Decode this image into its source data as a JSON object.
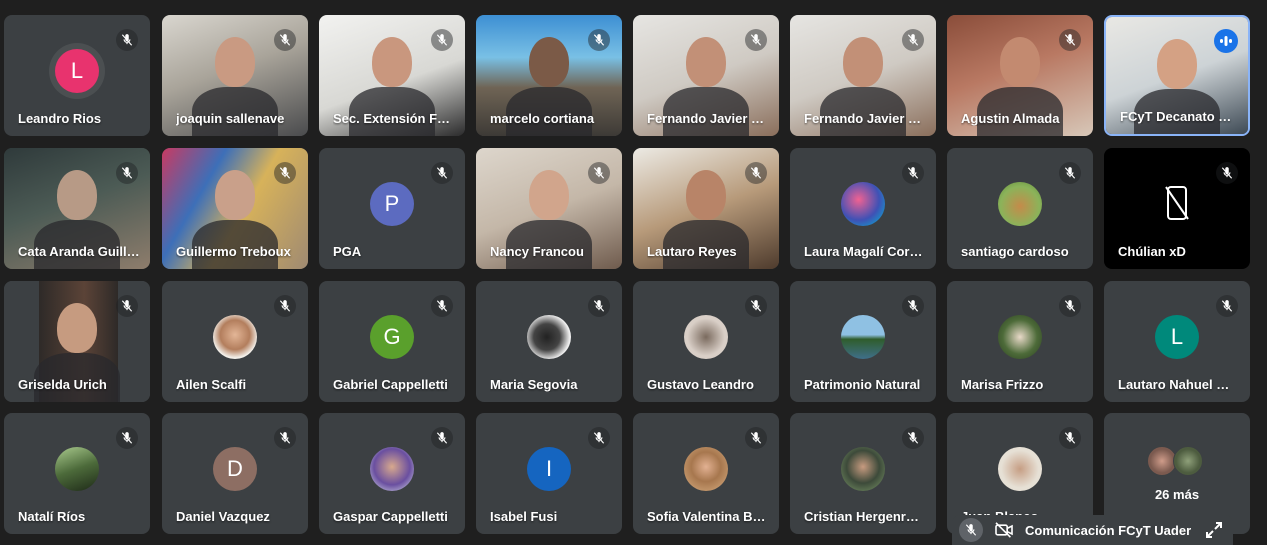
{
  "participants": [
    {
      "name": "Leandro Rios",
      "type": "initial",
      "initial": "L",
      "color": "#e8336e"
    },
    {
      "name": "joaquin sallenave",
      "type": "video",
      "bg": "linear-gradient(160deg,#d9d6cf 0%,#a9a49a 45%,#4a4b4d 100%)",
      "face": "#c99a82"
    },
    {
      "name": "Sec. Extensión FCyT",
      "type": "video",
      "bg": "linear-gradient(160deg,#f2f2f0 0%,#d8d8d4 55%,#2b2b2c 100%)",
      "face": "#c9977e"
    },
    {
      "name": "marcelo cortiana",
      "type": "video",
      "bg": "linear-gradient(180deg,#3d8fd3 0%,#79c0e5 35%,#6f6455 60%,#3d3a36 100%)",
      "face": "#7b5a47"
    },
    {
      "name": "Fernando Javier Rodriguez",
      "type": "video",
      "bg": "linear-gradient(160deg,#e6e5e2 0%,#cfcac3 50%,#8a6e5b 100%)",
      "face": "#c29077"
    },
    {
      "name": "Fernando Javier Rodriguez",
      "type": "video",
      "bg": "linear-gradient(160deg,#e6e5e2 0%,#cfcac3 50%,#8a6e5b 100%)",
      "face": "#c29077"
    },
    {
      "name": "Agustin Almada",
      "type": "video",
      "bg": "linear-gradient(160deg,#8a4d3a 0%,#b97963 45%,#d7c7b8 100%)",
      "face": "#c38a70"
    },
    {
      "name": "FCyT Decanato FCyT",
      "type": "video",
      "active": true,
      "bg": "linear-gradient(160deg,#e9e8e4 0%,#cdd3d6 50%,#3e4a55 100%)",
      "face": "#d4a184"
    },
    {
      "name": "Cata Aranda Guillermo",
      "type": "video",
      "bg": "linear-gradient(160deg,#2f3a3b 0%,#4c5b55 45%,#8e7d6c 100%)",
      "face": "#b79a86"
    },
    {
      "name": "Guillermo Treboux",
      "type": "video",
      "bg": "linear-gradient(120deg,#c83a62 0%,#3d6fb8 30%,#d7b25a 55%,#9f8a72 100%)",
      "face": "#c9a08a"
    },
    {
      "name": "PGA",
      "type": "initial",
      "initial": "P",
      "color": "#5c6bc0"
    },
    {
      "name": "Nancy Francou",
      "type": "video",
      "bg": "linear-gradient(160deg,#ddd6cc 0%,#c4b7a8 50%,#6f5b4d 100%)",
      "face": "#d1a58c"
    },
    {
      "name": "Lautaro Reyes",
      "type": "video",
      "bg": "linear-gradient(160deg,#eceae4 0%,#b79a7a 50%,#4e3b2d 100%)",
      "face": "#b88468"
    },
    {
      "name": "Laura Magalí Cordoba",
      "type": "photo",
      "color": "radial-gradient(circle at 40% 40%,#f06292 0%,#3f51b5 55%,#00bcd4 100%)"
    },
    {
      "name": "santiago cardoso",
      "type": "photo",
      "color": "radial-gradient(circle at 50% 55%,#c48b4a 0%,#8bb35a 60%,#5f8a3a 100%)"
    },
    {
      "name": "Chúlian xD",
      "type": "nocam"
    },
    {
      "name": "Griselda Urich",
      "type": "video",
      "bg": "linear-gradient(90deg,#3c4043 0%,#3c4043 24%,#2e2a28 24%,#5b4337 55%,#2e2a28 78%,#3c4043 78%)",
      "face": "#c69b80"
    },
    {
      "name": "Ailen Scalfi",
      "type": "photo",
      "color": "radial-gradient(circle at 50% 45%,#e3b697 0%,#b37e5d 45%,#f2efe9 70%)"
    },
    {
      "name": "Gabriel Cappelletti",
      "type": "initial",
      "initial": "G",
      "color": "#5aa02c"
    },
    {
      "name": "Maria Segovia",
      "type": "photo",
      "color": "radial-gradient(circle at 45% 50%,#222 0%,#444 40%,#efefef 70%)"
    },
    {
      "name": "Gustavo Leandro",
      "type": "photo",
      "color": "radial-gradient(circle at 50% 50%,#7a6a5e 0%,#d9cfc7 60%)"
    },
    {
      "name": "Patrimonio Natural",
      "type": "photo",
      "color": "linear-gradient(180deg,#8fc1e3 0%,#8fc1e3 45%,#2f5d2c 55%,#3f6f8a 100%)"
    },
    {
      "name": "Marisa Frizzo",
      "type": "photo",
      "color": "radial-gradient(circle at 50% 50%,#e8d9c8 0%,#4d6b39 55%,#2a3d20 100%)"
    },
    {
      "name": "Lautaro Nahuel Martinez",
      "type": "initial",
      "initial": "L",
      "color": "#00897b"
    },
    {
      "name": "Natalí Ríos",
      "type": "photo",
      "color": "linear-gradient(160deg,#aacb8e 0%,#4c6a3a 50%,#1e2a18 100%)"
    },
    {
      "name": "Daniel Vazquez",
      "type": "initial",
      "initial": "D",
      "color": "#8d6e63"
    },
    {
      "name": "Gaspar Cappelletti",
      "type": "photo",
      "color": "radial-gradient(circle at 50% 45%,#d8a98d 0%,#6a4fa0 55%,#dfe7ef 100%)"
    },
    {
      "name": "Isabel Fusi",
      "type": "initial",
      "initial": "I",
      "color": "#1565c0"
    },
    {
      "name": "Sofia Valentina Bustos",
      "type": "photo",
      "color": "radial-gradient(circle at 50% 45%,#e2b192 0%,#a7774e 45%,#d9b083 100%)"
    },
    {
      "name": "Cristian Hergenreder",
      "type": "photo",
      "color": "radial-gradient(circle at 50% 45%,#c79b80 0%,#3d4a3a 50%,#7d9b6a 100%)"
    },
    {
      "name": "Juan Blanco",
      "type": "photo",
      "color": "radial-gradient(circle at 50% 50%,#c69e84 0%,#e6e0d5 60%)"
    }
  ],
  "more": {
    "label": "26 más",
    "avatars": [
      "radial-gradient(circle at 50% 50%,#cf9c8a 0%,#7b5a4f 60%)",
      "radial-gradient(circle at 50% 50%,#8fa07a 0%,#4d5c3f 60%)"
    ]
  },
  "self_view": {
    "label": "Comunicación FCyT Uader"
  }
}
